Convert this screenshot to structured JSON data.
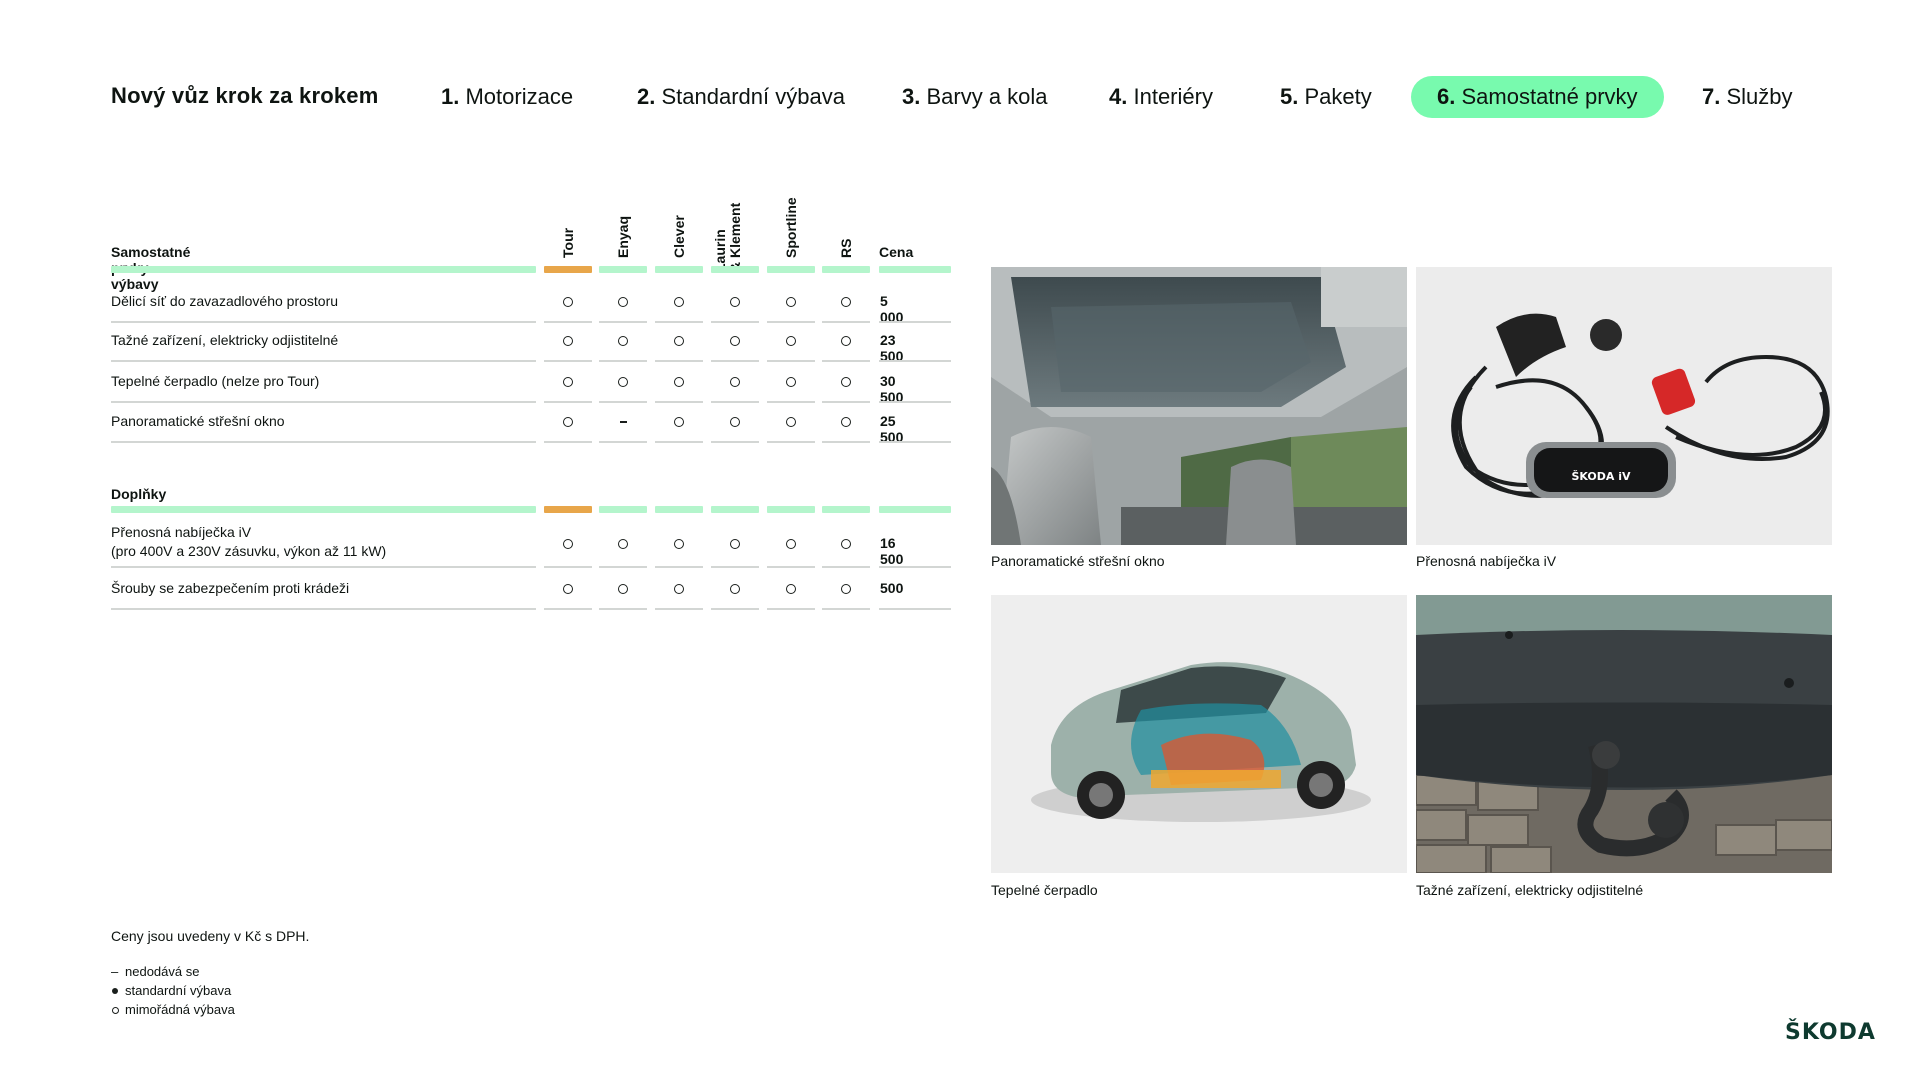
{
  "nav": {
    "title": "Nový vůz krok za krokem",
    "steps": [
      {
        "num": "1.",
        "label": "Motorizace",
        "active": false
      },
      {
        "num": "2.",
        "label": "Standardní výbava",
        "active": false
      },
      {
        "num": "3.",
        "label": "Barvy a kola",
        "active": false
      },
      {
        "num": "4.",
        "label": "Interiéry",
        "active": false
      },
      {
        "num": "5.",
        "label": "Pakety",
        "active": false
      },
      {
        "num": "6.",
        "label": "Samostatné prvky",
        "active": true
      },
      {
        "num": "7.",
        "label": "Služby",
        "active": false
      }
    ]
  },
  "table": {
    "columns": [
      "Tour",
      "Enyaq",
      "Clever",
      "Laurin\n& Klement",
      "Sportline",
      "RS"
    ],
    "column_lines": [
      [
        "Tour"
      ],
      [
        "Enyaq"
      ],
      [
        "Clever"
      ],
      [
        "Laurin",
        "& Klement"
      ],
      [
        "Sportline"
      ],
      [
        "RS"
      ]
    ],
    "price_header": "Cena",
    "sections": [
      {
        "title": "Samostatné prvky výbavy",
        "rows": [
          {
            "label": "Dělicí síť do zavazadlového prostoru",
            "marks": [
              "o",
              "o",
              "o",
              "o",
              "o",
              "o"
            ],
            "price": "5 000"
          },
          {
            "label": "Tažné zařízení, elektricky odjistitelné",
            "marks": [
              "o",
              "o",
              "o",
              "o",
              "o",
              "o"
            ],
            "price": "23 500"
          },
          {
            "label": "Tepelné čerpadlo (nelze pro Tour)",
            "marks": [
              "o",
              "o",
              "o",
              "o",
              "o",
              "o"
            ],
            "price": "30 500"
          },
          {
            "label": "Panoramatické střešní okno",
            "marks": [
              "o",
              "-",
              "o",
              "o",
              "o",
              "o"
            ],
            "price": "25 500"
          }
        ]
      },
      {
        "title": "Doplňky",
        "rows": [
          {
            "label": "Přenosná nabíječka iV",
            "label2": "(pro 400V a 230V zásuvku, výkon až 11 kW)",
            "marks": [
              "o",
              "o",
              "o",
              "o",
              "o",
              "o"
            ],
            "price": "16 500"
          },
          {
            "label": "Šrouby se zabezpečením proti krádeži",
            "marks": [
              "o",
              "o",
              "o",
              "o",
              "o",
              "o"
            ],
            "price": "500"
          }
        ]
      }
    ]
  },
  "notes": {
    "prices": "Ceny jsou uvedeny v Kč s DPH.",
    "legend": [
      {
        "symbol": "dash",
        "text": "nedodává se"
      },
      {
        "symbol": "dot",
        "text": "standardní výbava"
      },
      {
        "symbol": "ring",
        "text": "mimořádná výbava"
      }
    ]
  },
  "images": [
    {
      "caption": "Panoramatické střešní okno",
      "icon": "panoramic-roof-photo"
    },
    {
      "caption": "Přenosná nabíječka iV",
      "icon": "charger-photo",
      "badge": "ŠKODA iV"
    },
    {
      "caption": "Tepelné čerpadlo",
      "icon": "heat-pump-car-photo"
    },
    {
      "caption": "Tažné zařízení, elektricky odjistitelné",
      "icon": "tow-bar-photo"
    }
  ],
  "brand": {
    "logo": "ŠKODA",
    "accent": "#78faae",
    "highlight": "#e8a64a",
    "logo_color": "#0e3a2f"
  }
}
